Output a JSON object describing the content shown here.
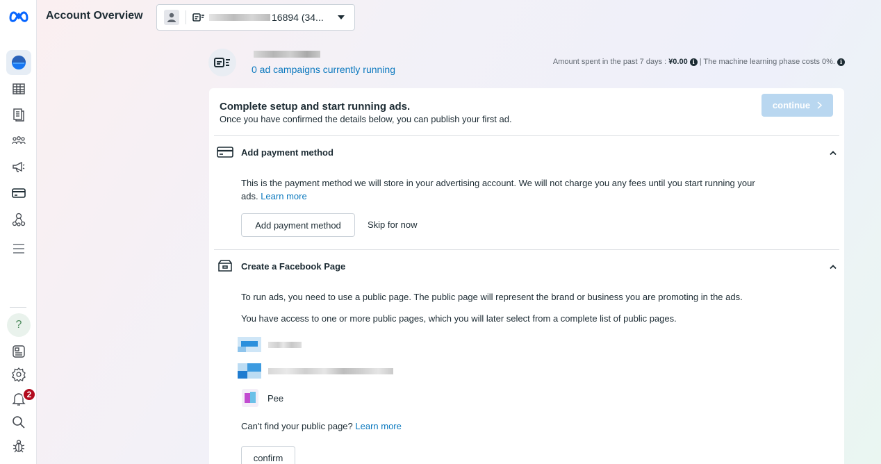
{
  "header": {
    "title": "Account Overview",
    "account_selector_text": "16894 (34..."
  },
  "summary": {
    "campaigns_link": "0 ad campaigns currently running",
    "spent_label": "Amount spent in the past 7 days :",
    "spent_value": "¥0.00",
    "ml_phase_text": "| The machine learning phase costs 0%."
  },
  "setup": {
    "title": "Complete setup and start running ads.",
    "subtitle": "Once you have confirmed the details below, you can publish your first ad.",
    "continue_label": "continue"
  },
  "payment": {
    "title": "Add payment method",
    "description": "This is the payment method we will store in your advertising account. We will not charge you any fees until you start running your ads.",
    "learn_more": "Learn more",
    "add_button": "Add payment method",
    "skip_button": "Skip for now"
  },
  "facebook_page": {
    "title": "Create a Facebook Page",
    "description_1": "To run ads, you need to use a public page. The public page will represent the brand or business you are promoting in the ads.",
    "description_2": "You have access to one or more public pages, which you will later select from a complete list of public pages.",
    "pages": [
      {
        "name": ""
      },
      {
        "name": ""
      },
      {
        "name": "Pee"
      }
    ],
    "cant_find": "Can't find your public page?",
    "learn_more": "Learn more",
    "confirm_button": "confirm"
  },
  "sidebar": {
    "items": [
      {
        "icon": "account-overview-icon",
        "active": true
      },
      {
        "icon": "table-icon"
      },
      {
        "icon": "reports-icon"
      },
      {
        "icon": "audiences-icon"
      },
      {
        "icon": "megaphone-icon"
      },
      {
        "icon": "billing-card-icon"
      },
      {
        "icon": "business-network-icon"
      },
      {
        "icon": "menu-icon"
      }
    ],
    "bottom": [
      {
        "icon": "help-icon",
        "label": "?"
      },
      {
        "icon": "news-icon"
      },
      {
        "icon": "settings-icon"
      },
      {
        "icon": "notifications-icon",
        "badge": "2"
      },
      {
        "icon": "search-icon"
      },
      {
        "icon": "bug-icon"
      }
    ]
  },
  "colors": {
    "accent": "#0a78be",
    "continue_disabled": "#b9d7f0",
    "badge": "#b20b1e",
    "meta_blue": "#0866ff"
  }
}
